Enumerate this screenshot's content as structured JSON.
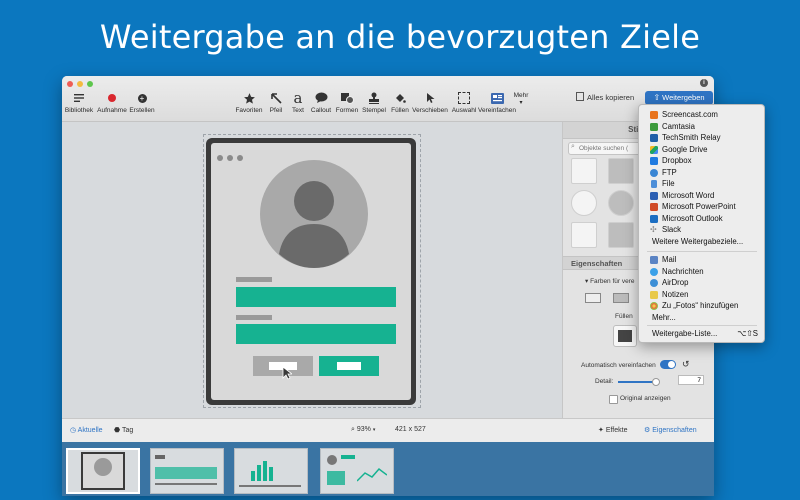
{
  "headline": "Weitergabe an die bevorzugten Ziele",
  "toolbar": {
    "left": [
      {
        "label": "Bibliothek",
        "icon": "library-icon"
      },
      {
        "label": "Aufnahme",
        "icon": "record-icon"
      },
      {
        "label": "Erstellen",
        "icon": "create-icon"
      }
    ],
    "tools": [
      {
        "label": "Favoriten",
        "icon": "star-icon"
      },
      {
        "label": "Pfeil",
        "icon": "arrow-icon"
      },
      {
        "label": "Text",
        "icon": "text-icon",
        "glyph": "a"
      },
      {
        "label": "Callout",
        "icon": "callout-icon"
      },
      {
        "label": "Formen",
        "icon": "shapes-icon"
      },
      {
        "label": "Stempel",
        "icon": "stamp-icon"
      },
      {
        "label": "Füllen",
        "icon": "fill-icon"
      },
      {
        "label": "Verschieben",
        "icon": "move-icon"
      },
      {
        "label": "Auswahl",
        "icon": "selection-icon"
      },
      {
        "label": "Vereinfachen",
        "icon": "simplify-icon"
      }
    ],
    "more_label": "Mehr",
    "copy_all_label": "Alles kopieren",
    "share_label": "Weitergeben"
  },
  "right_panel": {
    "styles_title": "Stilau",
    "search_placeholder": "Objekte suchen (",
    "properties_title": "Eigenschaften",
    "colors_label": "Farben für vere",
    "fill_label": "Füllen",
    "auto_simplify_label": "Automatisch vereinfachen",
    "detail_label": "Detail:",
    "detail_value": "7",
    "show_original_label": "Original anzeigen"
  },
  "statusbar": {
    "recent_label": "Aktuelle",
    "tag_label": "Tag",
    "zoom": "93%",
    "dimensions": "421 x 527",
    "effects_label": "Effekte",
    "properties_label": "Eigenschaften"
  },
  "share_menu": {
    "items": [
      {
        "label": "Screencast.com",
        "color": "#e8731c"
      },
      {
        "label": "Camtasia",
        "color": "#3c9a3c"
      },
      {
        "label": "TechSmith Relay",
        "color": "#1f5fa8"
      },
      {
        "label": "Google Drive",
        "color": "#f2b824"
      },
      {
        "label": "Dropbox",
        "color": "#1f7ae0"
      },
      {
        "label": "FTP",
        "color": "#3a86d4"
      },
      {
        "label": "File",
        "color": "#4d8ed8"
      },
      {
        "label": "Microsoft Word",
        "color": "#2b5fb3"
      },
      {
        "label": "Microsoft PowerPoint",
        "color": "#d04a26"
      },
      {
        "label": "Microsoft Outlook",
        "color": "#1b6ec2"
      },
      {
        "label": "Slack",
        "color": "#8a8a8a"
      }
    ],
    "more_destinations": "Weitere Weitergabeziele...",
    "system_items": [
      {
        "label": "Mail",
        "color": "#5b84c4"
      },
      {
        "label": "Nachrichten",
        "color": "#3aa0e8"
      },
      {
        "label": "AirDrop",
        "color": "#3d8fd6"
      },
      {
        "label": "Notizen",
        "color": "#e8c94a"
      },
      {
        "label": "Zu „Fotos“ hinzufügen",
        "color": "#e07a3c"
      }
    ],
    "more_label": "Mehr...",
    "list_label": "Weitergabe-Liste...",
    "list_shortcut": "⌥⇧S"
  }
}
